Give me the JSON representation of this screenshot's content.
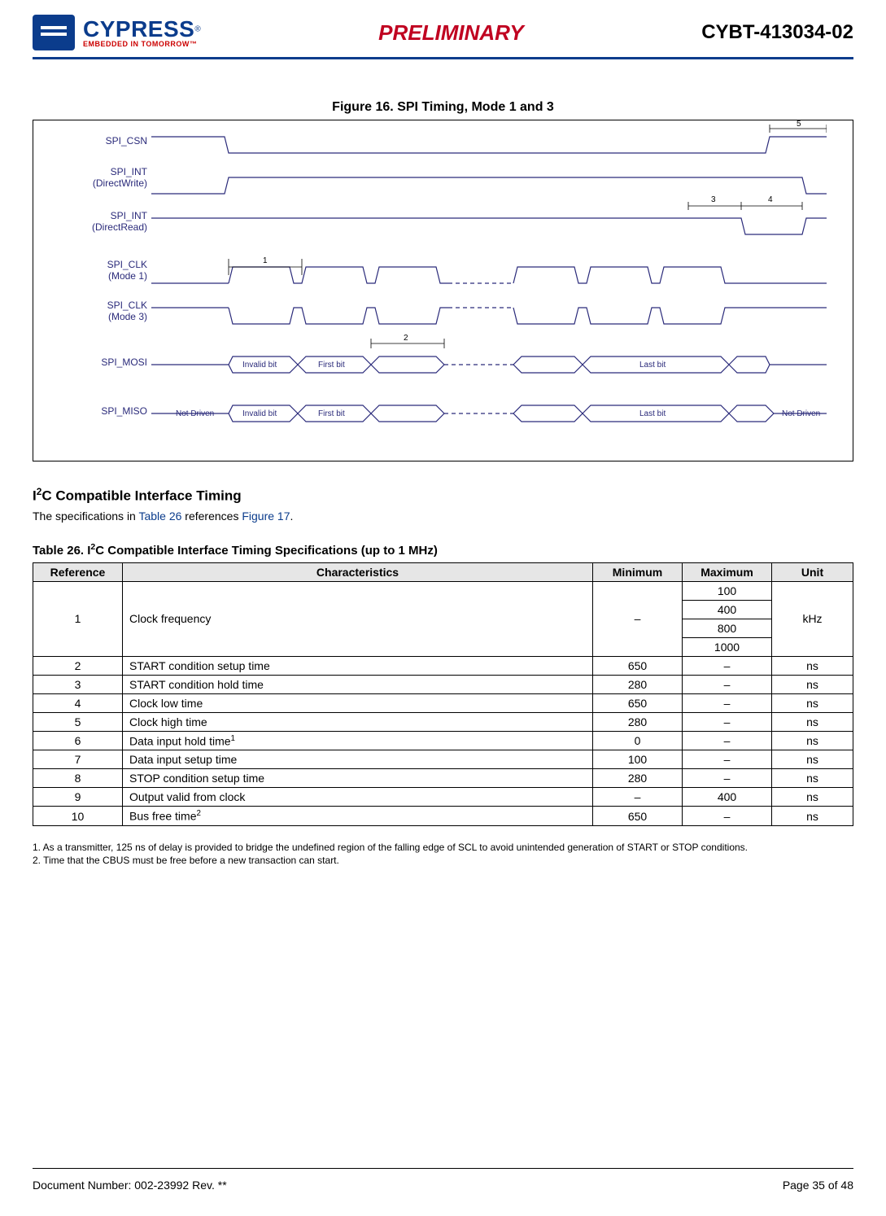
{
  "header": {
    "brand_main": "CYPRESS",
    "brand_reg": "®",
    "brand_sub": "EMBEDDED IN TOMORROW™",
    "status": "PRELIMINARY",
    "partno": "CYBT-413034-02"
  },
  "figure": {
    "caption": "Figure 16.  SPI Timing, Mode 1 and 3",
    "signals": {
      "csn": "SPI_CSN",
      "int_dw": "SPI_INT\n(DirectWrite)",
      "int_dr": "SPI_INT\n(DirectRead)",
      "clk_m1": "SPI_CLK\n(Mode 1)",
      "clk_m3": "SPI_CLK\n(Mode 3)",
      "mosi": "SPI_MOSI",
      "miso": "SPI_MISO"
    },
    "annot": {
      "invalid": "Invalid bit",
      "first": "First bit",
      "last": "Last bit",
      "notdriven": "Not Driven",
      "d1": "1",
      "d2": "2",
      "d3": "3",
      "d4": "4",
      "d5": "5"
    }
  },
  "section": {
    "heading_pre": "I",
    "heading_sup": "2",
    "heading_post": "C Compatible Interface Timing",
    "para_pre": "The specifications in ",
    "para_link1": "Table 26",
    "para_mid": " references ",
    "para_link2": "Figure 17",
    "para_end": "."
  },
  "table": {
    "caption_pre": "Table 26.  I",
    "caption_sup": "2",
    "caption_post": "C Compatible Interface Timing Specifications (up to 1 MHz)",
    "head": {
      "ref": "Reference",
      "char": "Characteristics",
      "min": "Minimum",
      "max": "Maximum",
      "unit": "Unit"
    },
    "r1": {
      "ref": "1",
      "char": "Clock frequency",
      "min": "–",
      "max1": "100",
      "max2": "400",
      "max3": "800",
      "max4": "1000",
      "unit": "kHz"
    },
    "rows": [
      {
        "ref": "2",
        "char": "START condition setup time",
        "min": "650",
        "max": "–",
        "unit": "ns"
      },
      {
        "ref": "3",
        "char": "START condition hold time",
        "min": "280",
        "max": "–",
        "unit": "ns"
      },
      {
        "ref": "4",
        "char": "Clock low time",
        "min": "650",
        "max": "–",
        "unit": "ns"
      },
      {
        "ref": "5",
        "char": "Clock high time",
        "min": "280",
        "max": "–",
        "unit": "ns"
      },
      {
        "ref": "6",
        "char": "Data input hold time",
        "sup": "1",
        "min": "0",
        "max": "–",
        "unit": "ns"
      },
      {
        "ref": "7",
        "char": "Data input setup time",
        "min": "100",
        "max": "–",
        "unit": "ns"
      },
      {
        "ref": "8",
        "char": "STOP condition setup time",
        "min": "280",
        "max": "–",
        "unit": "ns"
      },
      {
        "ref": "9",
        "char": "Output valid from clock",
        "min": "–",
        "max": "400",
        "unit": "ns"
      },
      {
        "ref": "10",
        "char": "Bus free time",
        "sup": "2",
        "min": "650",
        "max": "–",
        "unit": "ns"
      }
    ]
  },
  "footnotes": {
    "n1": "1. As a transmitter, 125 ns of delay is provided to bridge the undefined region of the falling edge of SCL to avoid unintended generation of START or STOP conditions.",
    "n2": "2. Time that the CBUS must be free before a new transaction can start."
  },
  "footer": {
    "left": "Document Number: 002-23992 Rev. **",
    "right": "Page 35 of 48"
  }
}
